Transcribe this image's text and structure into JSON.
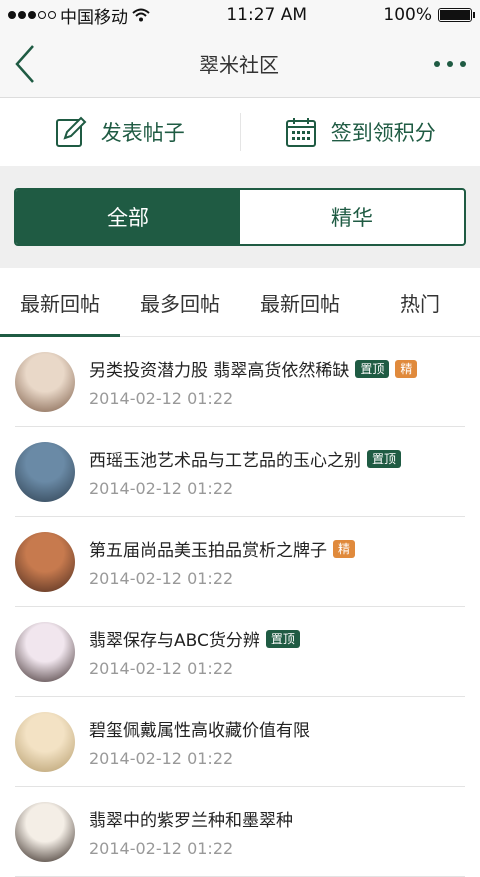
{
  "status": {
    "carrier": "中国移动",
    "time": "11:27 AM",
    "battery": "100%",
    "battery_fraction": 1.0
  },
  "nav": {
    "title": "翠米社区"
  },
  "actions": {
    "post_label": "发表帖子",
    "checkin_label": "签到领积分"
  },
  "segment": {
    "all": "全部",
    "featured": "精华"
  },
  "tabs": [
    "最新回帖",
    "最多回帖",
    "最新回帖",
    "热门"
  ],
  "badges": {
    "top": "置顶",
    "essence": "精"
  },
  "posts": [
    {
      "title": "另类投资潜力股 翡翠高货依然稀缺",
      "date": "2014-02-12 01:22",
      "top": true,
      "essence": true,
      "avatar_colors": [
        "#e9d8c8",
        "#7a5a45"
      ]
    },
    {
      "title": "西瑶玉池艺术品与工艺品的玉心之别",
      "date": "2014-02-12 01:22",
      "top": true,
      "essence": false,
      "avatar_colors": [
        "#6a8aa6",
        "#2d3e4e"
      ]
    },
    {
      "title": "第五届尚品美玉拍品赏析之牌子",
      "date": "2014-02-12 01:22",
      "top": false,
      "essence": true,
      "avatar_colors": [
        "#c77a4e",
        "#4a2a1e"
      ]
    },
    {
      "title": "翡翠保存与ABC货分辨",
      "date": "2014-02-12 01:22",
      "top": true,
      "essence": false,
      "avatar_colors": [
        "#f1e6ee",
        "#3a2a2a"
      ]
    },
    {
      "title": "碧玺佩戴属性高收藏价值有限",
      "date": "2014-02-12 01:22",
      "top": false,
      "essence": false,
      "avatar_colors": [
        "#f3e2c4",
        "#b39a6a"
      ]
    },
    {
      "title": "翡翠中的紫罗兰种和墨翠种",
      "date": "2014-02-12 01:22",
      "top": false,
      "essence": false,
      "avatar_colors": [
        "#f4eee6",
        "#2a1e18"
      ]
    }
  ]
}
